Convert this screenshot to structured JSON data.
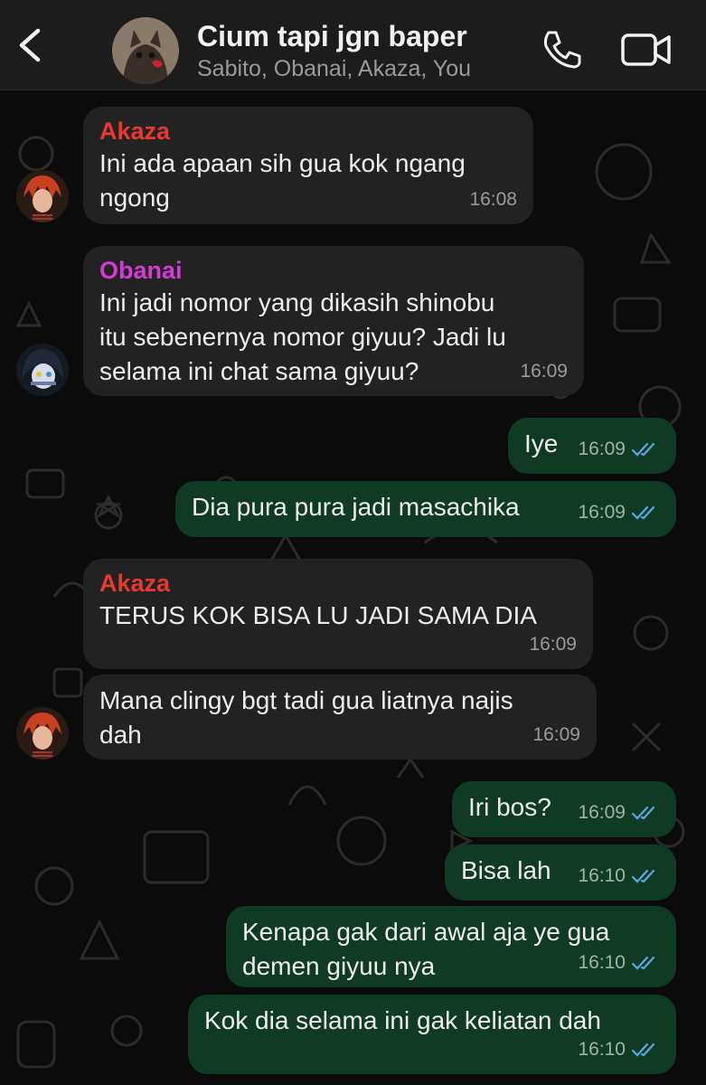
{
  "header": {
    "title": "Cium tapi jgn baper",
    "members": "Sabito, Obanai, Akaza, You"
  },
  "colors": {
    "akaza": "#e8392e",
    "obanai": "#d43ad4",
    "incoming_bubble": "#222222",
    "outgoing_bubble": "#0f3b24",
    "read_ticks": "#5aa8e8"
  },
  "messages": [
    {
      "sender": "Akaza",
      "text_lines": [
        "Ini ada apaan sih gua kok ngang",
        "ngong"
      ],
      "time": "16:08"
    },
    {
      "sender": "Obanai",
      "text_lines": [
        "Ini jadi nomor yang dikasih shinobu",
        "itu sebenernya nomor giyuu? Jadi lu",
        "selama ini chat sama giyuu?"
      ],
      "time": "16:09"
    },
    {
      "text": "Iye",
      "time": "16:09"
    },
    {
      "text": "Dia pura pura jadi masachika",
      "time": "16:09"
    },
    {
      "sender": "Akaza",
      "text": "TERUS KOK BISA LU JADI SAMA DIA",
      "time": "16:09"
    },
    {
      "text_lines": [
        "Mana clingy bgt tadi gua liatnya najis",
        "dah"
      ],
      "time": "16:09"
    },
    {
      "text": "Iri bos?",
      "time": "16:09"
    },
    {
      "text": "Bisa lah",
      "time": "16:10"
    },
    {
      "text_lines": [
        "Kenapa gak dari awal aja ye gua",
        "demen giyuu nya"
      ],
      "time": "16:10"
    },
    {
      "text": "Kok dia selama ini gak keliatan dah",
      "time": "16:10"
    }
  ]
}
